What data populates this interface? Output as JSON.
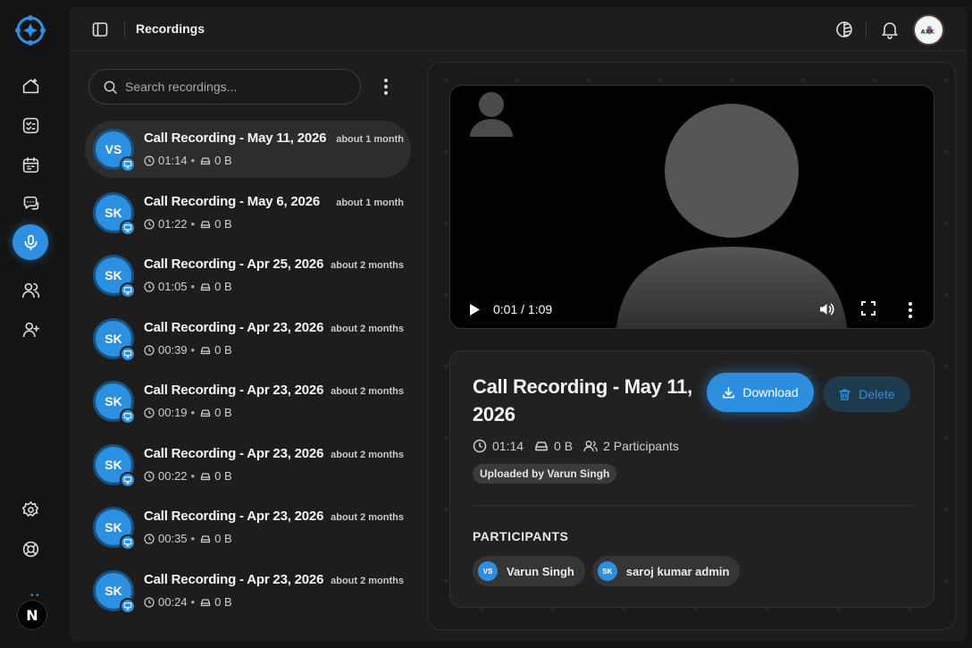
{
  "header": {
    "title": "Recordings",
    "avatar_text": "AXK"
  },
  "search": {
    "placeholder": "Search recordings..."
  },
  "recordings": [
    {
      "initials": "VS",
      "title": "Call Recording - May 11, 2026",
      "ago": "about 1 month",
      "duration": "01:14",
      "size": "0 B",
      "active": true
    },
    {
      "initials": "SK",
      "title": "Call Recording - May 6, 2026",
      "ago": "about 1 month",
      "duration": "01:22",
      "size": "0 B"
    },
    {
      "initials": "SK",
      "title": "Call Recording - Apr 25, 2026",
      "ago": "about 2 months",
      "duration": "01:05",
      "size": "0 B"
    },
    {
      "initials": "SK",
      "title": "Call Recording - Apr 23, 2026",
      "ago": "about 2 months",
      "duration": "00:39",
      "size": "0 B"
    },
    {
      "initials": "SK",
      "title": "Call Recording - Apr 23, 2026",
      "ago": "about 2 months",
      "duration": "00:19",
      "size": "0 B"
    },
    {
      "initials": "SK",
      "title": "Call Recording - Apr 23, 2026",
      "ago": "about 2 months",
      "duration": "00:22",
      "size": "0 B"
    },
    {
      "initials": "SK",
      "title": "Call Recording - Apr 23, 2026",
      "ago": "about 2 months",
      "duration": "00:35",
      "size": "0 B"
    },
    {
      "initials": "SK",
      "title": "Call Recording - Apr 23, 2026",
      "ago": "about 2 months",
      "duration": "00:24",
      "size": "0 B"
    }
  ],
  "player": {
    "time": "0:01 / 1:09"
  },
  "detail": {
    "title": "Call Recording - May 11, 2026",
    "duration": "01:14",
    "size": "0 B",
    "participants_count": "2 Participants",
    "uploaded_by": "Uploaded by Varun Singh",
    "download_label": "Download",
    "delete_label": "Delete",
    "participants_heading": "PARTICIPANTS",
    "participants": [
      {
        "initials": "VS",
        "name": "Varun Singh"
      },
      {
        "initials": "SK",
        "name": "saroj kumar admin"
      }
    ]
  },
  "rail": {
    "bottom_badge": "N"
  },
  "colors": {
    "accent": "#2f8fe0",
    "background": "#141414",
    "panel": "#1d1d1d"
  }
}
